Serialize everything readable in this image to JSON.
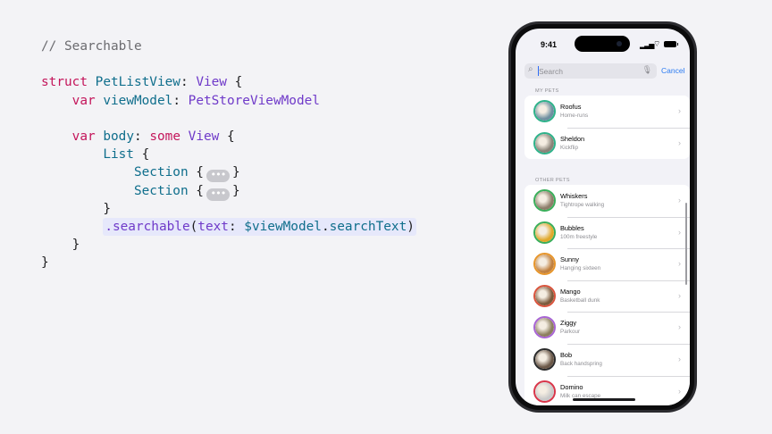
{
  "code": {
    "comment": "// Searchable",
    "l2": {
      "kw": "struct",
      "name": "PetListView",
      "colon": ":",
      "type": "View",
      "brace": "{"
    },
    "l3": {
      "kw": "var",
      "name": "viewModel",
      "colon": ":",
      "type": "PetStoreViewModel"
    },
    "l5": {
      "kw": "var",
      "name": "body",
      "colon": ":",
      "some": "some",
      "type": "View",
      "brace": "{"
    },
    "l6": {
      "name": "List",
      "brace": "{"
    },
    "l7": {
      "name": "Section",
      "open": "{",
      "ellipsis": "•••",
      "close": "}"
    },
    "l8": {
      "name": "Section",
      "open": "{",
      "ellipsis": "•••",
      "close": "}"
    },
    "l9": "}",
    "l10": {
      "dot": ".",
      "method": "searchable",
      "open": "(",
      "label": "text",
      "colon": ":",
      "binding": "$viewModel",
      "dot2": ".",
      "prop": "searchText",
      "close": ")"
    },
    "l11": "}",
    "l12": "}"
  },
  "phone": {
    "status": {
      "time": "9:41"
    },
    "search": {
      "placeholder": "Search",
      "value": "",
      "cancel_label": "Cancel"
    },
    "my_pets": {
      "header": "MY PETS",
      "items": [
        {
          "name": "Roofus",
          "subtitle": "Home-runs",
          "ring": "#2fb28a",
          "fill": "#6e8fa0"
        },
        {
          "name": "Sheldon",
          "subtitle": "Kickflip",
          "ring": "#2fb28a",
          "fill": "#8a8378"
        }
      ]
    },
    "other_pets": {
      "header": "OTHER PETS",
      "items": [
        {
          "name": "Whiskers",
          "subtitle": "Tightrope walking",
          "ring": "#3aae5a",
          "fill": "#8d7d6a"
        },
        {
          "name": "Bubbles",
          "subtitle": "100m freestyle",
          "ring": "#3aae5a",
          "fill": "#e0a82a"
        },
        {
          "name": "Sunny",
          "subtitle": "Hanging sixteen",
          "ring": "#e7962c",
          "fill": "#c0803f"
        },
        {
          "name": "Mango",
          "subtitle": "Basketball dunk",
          "ring": "#d9543d",
          "fill": "#7b5a3b"
        },
        {
          "name": "Ziggy",
          "subtitle": "Parkour",
          "ring": "#a865d4",
          "fill": "#8c7f5f"
        },
        {
          "name": "Bob",
          "subtitle": "Back handspring",
          "ring": "#2b2b2b",
          "fill": "#6b5848"
        },
        {
          "name": "Domino",
          "subtitle": "Milk can escape",
          "ring": "#d9364a",
          "fill": "#c9c9c9"
        }
      ]
    }
  }
}
